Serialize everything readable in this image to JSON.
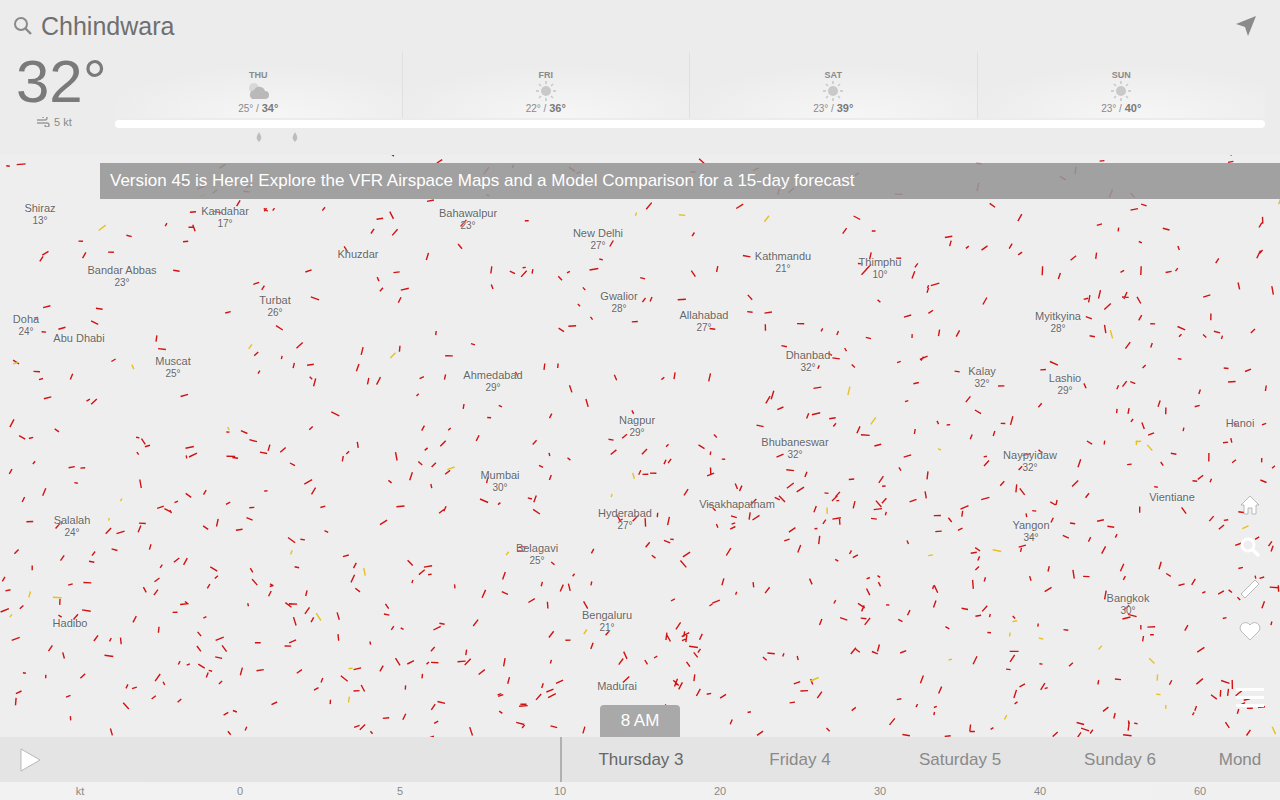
{
  "search": {
    "value": "Chhindwara"
  },
  "current": {
    "temp": "32°",
    "wind": "5 kt"
  },
  "forecast": [
    {
      "day": "THU",
      "low": "25°",
      "high": "34°",
      "kind": "cloudy",
      "rain": true
    },
    {
      "day": "FRI",
      "low": "22°",
      "high": "36°",
      "kind": "sunny",
      "rain": false
    },
    {
      "day": "SAT",
      "low": "23°",
      "high": "39°",
      "kind": "sunny",
      "rain": false
    },
    {
      "day": "SUN",
      "low": "23°",
      "high": "40°",
      "kind": "sunny",
      "rain": false
    }
  ],
  "banner": "Version 45 is Here! Explore the VFR Airspace Maps and a Model Comparison for a 15-day forecast",
  "cities": [
    {
      "name": "Shiraz",
      "temp": "13°"
    },
    {
      "name": "Kandahar",
      "temp": "17°"
    },
    {
      "name": "Bahawalpur",
      "temp": "23°"
    },
    {
      "name": "New Delhi",
      "temp": "27°"
    },
    {
      "name": "Kathmandu",
      "temp": "21°"
    },
    {
      "name": "Thimphu",
      "temp": "10°"
    },
    {
      "name": "Khuzdar",
      "temp": ""
    },
    {
      "name": "Bandar Abbas",
      "temp": "23°"
    },
    {
      "name": "Turbat",
      "temp": "26°"
    },
    {
      "name": "Gwalior",
      "temp": "28°"
    },
    {
      "name": "Allahabad",
      "temp": "27°"
    },
    {
      "name": "Myitkyina",
      "temp": "28°"
    },
    {
      "name": "Doha",
      "temp": "24°"
    },
    {
      "name": "Abu Dhabi",
      "temp": ""
    },
    {
      "name": "Muscat",
      "temp": "25°"
    },
    {
      "name": "Dhanbad",
      "temp": "32°"
    },
    {
      "name": "Kalay",
      "temp": "32°"
    },
    {
      "name": "Lashio",
      "temp": "29°"
    },
    {
      "name": "Ahmedabad",
      "temp": "29°"
    },
    {
      "name": "Nagpur",
      "temp": "29°"
    },
    {
      "name": "Hanoi",
      "temp": ""
    },
    {
      "name": "Bhubaneswar",
      "temp": "32°"
    },
    {
      "name": "Naypyidaw",
      "temp": "32°"
    },
    {
      "name": "Mumbai",
      "temp": "30°"
    },
    {
      "name": "Visakhapatnam",
      "temp": ""
    },
    {
      "name": "Vientiane",
      "temp": ""
    },
    {
      "name": "Salalah",
      "temp": "24°"
    },
    {
      "name": "Hyderabad",
      "temp": "27°"
    },
    {
      "name": "Yangon",
      "temp": "34°"
    },
    {
      "name": "Belagavi",
      "temp": "25°"
    },
    {
      "name": "Bangkok",
      "temp": "30°"
    },
    {
      "name": "Bengaluru",
      "temp": "21°"
    },
    {
      "name": "Hadibo",
      "temp": ""
    },
    {
      "name": "Madurai",
      "temp": ""
    }
  ],
  "timeline": {
    "time": "8 AM",
    "days": [
      {
        "label": "Thursday 3",
        "selected": true
      },
      {
        "label": "Friday 4",
        "selected": false
      },
      {
        "label": "Saturday 5",
        "selected": false
      },
      {
        "label": "Sunday 6",
        "selected": false
      },
      {
        "label": "Mond",
        "selected": false
      }
    ]
  },
  "scale": {
    "unit": "kt",
    "ticks": [
      "0",
      "5",
      "10",
      "20",
      "30",
      "40",
      "60"
    ]
  }
}
